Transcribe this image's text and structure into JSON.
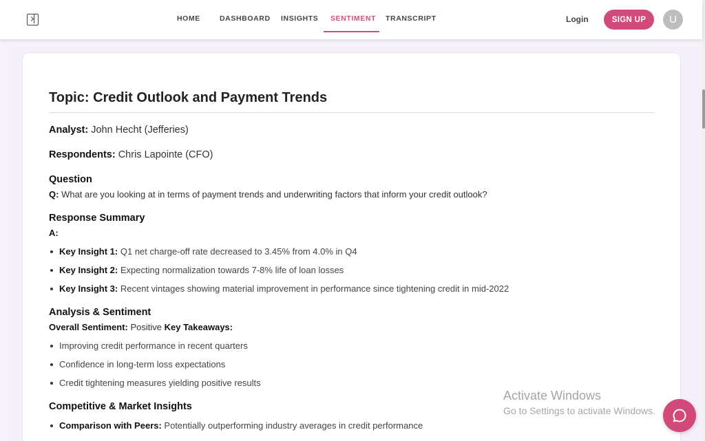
{
  "nav": {
    "items": [
      "HOME",
      "DASHBOARD",
      "INSIGHTS",
      "SENTIMENT",
      "TRANSCRIPT"
    ],
    "active": "SENTIMENT",
    "login": "Login",
    "signup": "SIGN UP",
    "avatar_initial": "U"
  },
  "colors": {
    "accent": "#d14a7a"
  },
  "card": {
    "topic": "Topic: Credit Outlook and Payment Trends",
    "analyst_label": "Analyst:",
    "analyst_value": " John Hecht (Jefferies)",
    "respondents_label": "Respondents:",
    "respondents_value": " Chris Lapointe (CFO)",
    "question_heading": "Question",
    "question_label": "Q:",
    "question_text": " What are you looking at in terms of payment trends and underwriting factors that inform your credit outlook?",
    "response_heading": "Response Summary",
    "answer_label": "A:",
    "insights": [
      {
        "label": "Key Insight 1:",
        "text": " Q1 net charge-off rate decreased to 3.45% from 4.0% in Q4"
      },
      {
        "label": "Key Insight 2:",
        "text": " Expecting normalization towards 7-8% life of loan losses"
      },
      {
        "label": "Key Insight 3:",
        "text": " Recent vintages showing material improvement in performance since tightening credit in mid-2022"
      }
    ],
    "analysis_heading": "Analysis & Sentiment",
    "sentiment_label": "Overall Sentiment:",
    "sentiment_value": " Positive ",
    "takeaways_label": "Key Takeaways:",
    "takeaways": [
      "Improving credit performance in recent quarters",
      "Confidence in long-term loss expectations",
      "Credit tightening measures yielding positive results"
    ],
    "competitive_heading": "Competitive & Market Insights",
    "competitive": [
      {
        "label": "Comparison with Peers:",
        "text": " Potentially outperforming industry averages in credit performance"
      }
    ]
  },
  "watermark": {
    "title": "Activate Windows",
    "subtitle": "Go to Settings to activate Windows."
  },
  "icons": {
    "sidebar": "sidebar-toggle-icon",
    "chat": "chat-bubble-icon"
  }
}
